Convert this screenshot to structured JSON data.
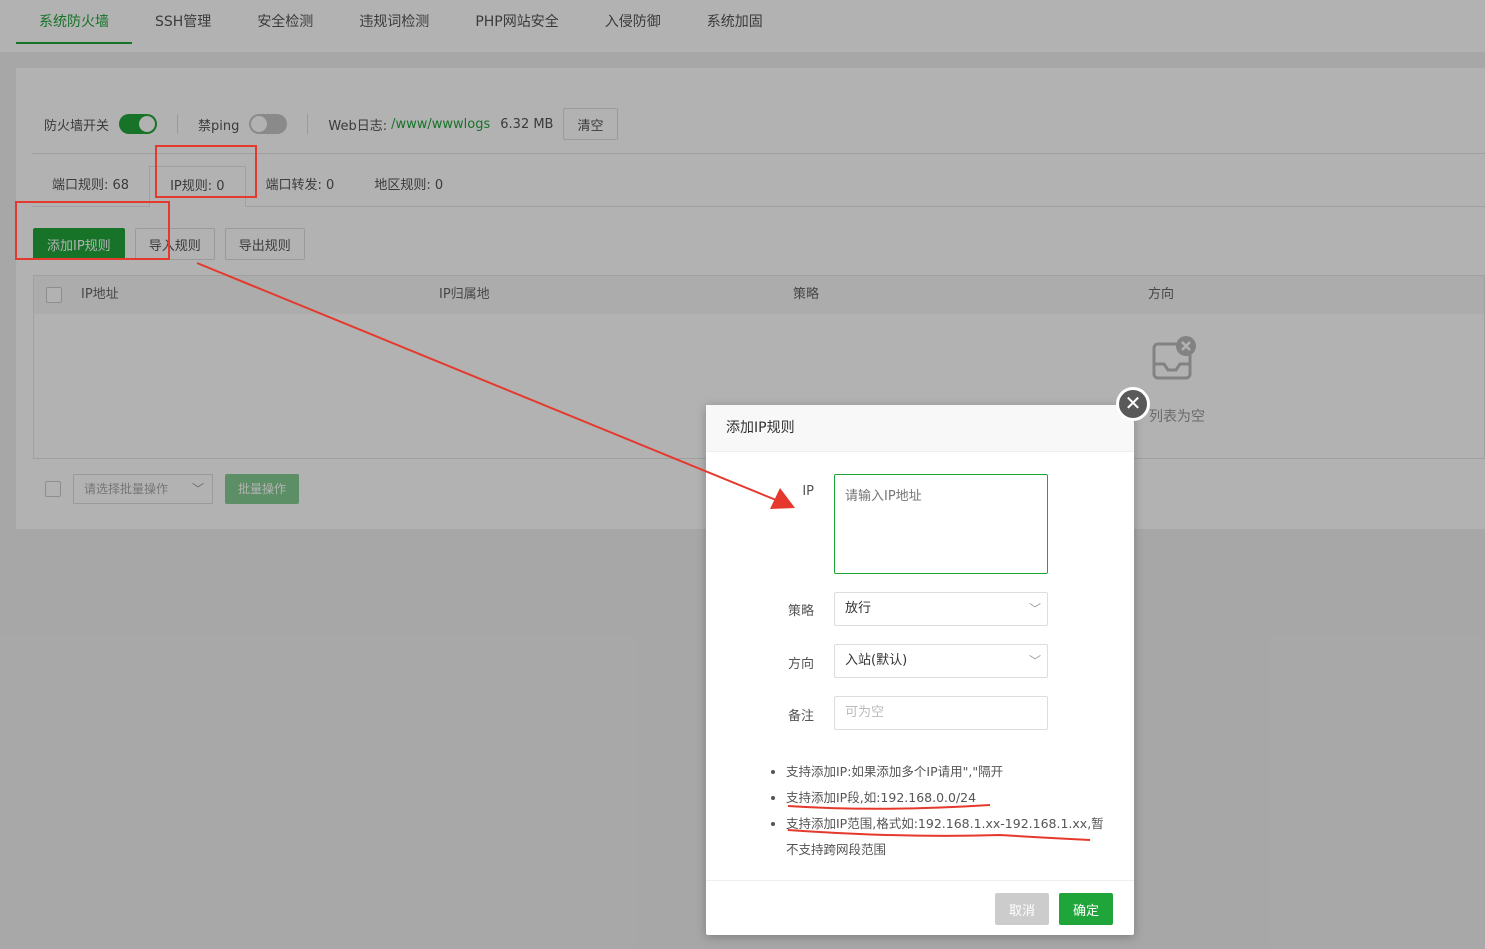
{
  "tabs": [
    "系统防火墙",
    "SSH管理",
    "安全检测",
    "违规词检测",
    "PHP网站安全",
    "入侵防御",
    "系统加固"
  ],
  "controls": {
    "firewall_label": "防火墙开关",
    "ping_label": "禁ping",
    "weblog_label": "Web日志:",
    "weblog_path": "/www/wwwlogs",
    "weblog_size": "6.32 MB",
    "clear_button": "清空",
    "firewall_enabled": true,
    "ping_blocked": false
  },
  "subtabs": [
    "端口规则: 68",
    "IP规则: 0",
    "端口转发: 0",
    "地区规则: 0"
  ],
  "actions": {
    "add": "添加IP规则",
    "import": "导入规则",
    "export": "导出规则"
  },
  "table": {
    "headers": [
      "IP地址",
      "IP归属地",
      "策略",
      "方向"
    ],
    "empty_text": "列表为空"
  },
  "batch": {
    "select_placeholder": "请选择批量操作",
    "button": "批量操作"
  },
  "dialog": {
    "title": "添加IP规则",
    "ip_label": "IP",
    "ip_placeholder": "请输入IP地址",
    "policy_label": "策略",
    "policy_value": "放行",
    "direction_label": "方向",
    "direction_value": "入站(默认)",
    "remark_label": "备注",
    "remark_placeholder": "可为空",
    "tips": [
      "支持添加IP:如果添加多个IP请用\",\"隔开",
      "支持添加IP段,如:192.168.0.0/24",
      "支持添加IP范围,格式如:192.168.1.xx-192.168.1.xx,暂不支持跨网段范围"
    ],
    "cancel": "取消",
    "ok": "确定"
  },
  "colors": {
    "accent": "#20a53a",
    "annotation": "#e5392d"
  }
}
